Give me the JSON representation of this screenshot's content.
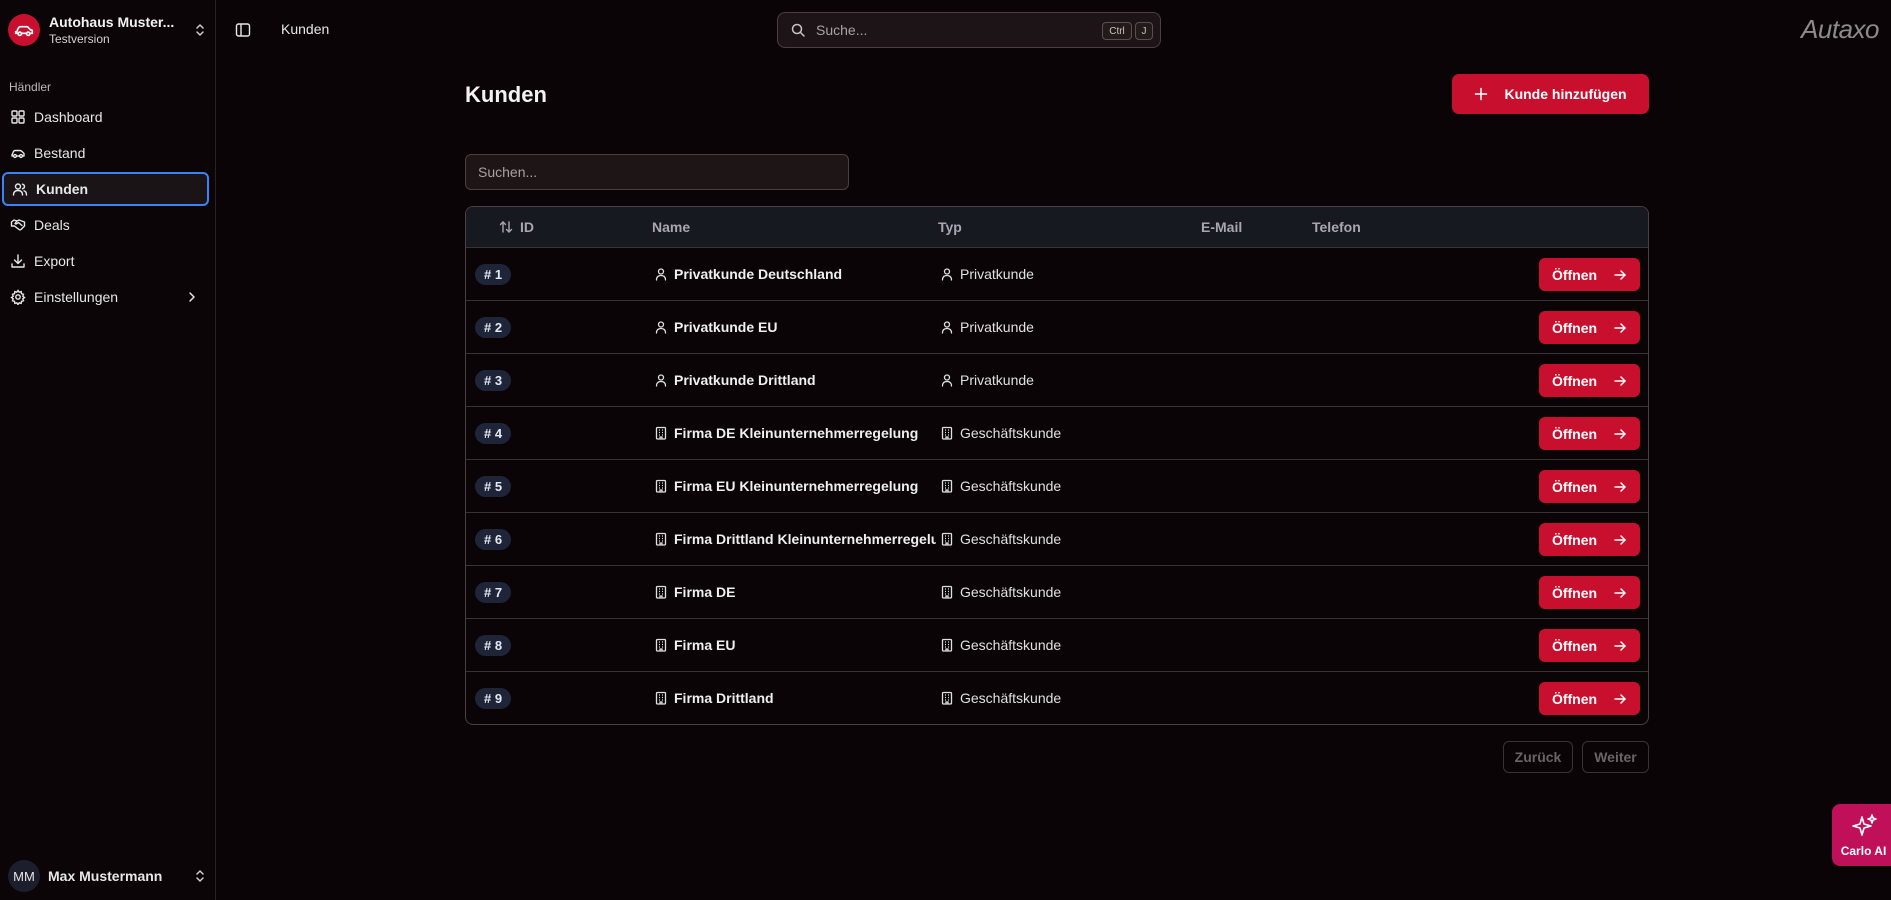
{
  "sidebar": {
    "org_name": "Autohaus Muster...",
    "org_sub": "Testversion",
    "section_label": "Händler",
    "items": [
      {
        "label": "Dashboard",
        "icon": "dashboard-icon"
      },
      {
        "label": "Bestand",
        "icon": "car-icon"
      },
      {
        "label": "Kunden",
        "icon": "users-icon",
        "active": true
      },
      {
        "label": "Deals",
        "icon": "handshake-icon"
      },
      {
        "label": "Export",
        "icon": "download-icon"
      },
      {
        "label": "Einstellungen",
        "icon": "settings-icon",
        "has_submenu": true
      }
    ],
    "user_initials": "MM",
    "user_name": "Max Mustermann"
  },
  "topbar": {
    "breadcrumb": "Kunden",
    "search_placeholder": "Suche...",
    "shortcut_ctrl": "Ctrl",
    "shortcut_key": "J",
    "brand": "Autaxo"
  },
  "main": {
    "title": "Kunden",
    "add_button": "Kunde hinzufügen",
    "search_placeholder": "Suchen...",
    "columns": {
      "id": "ID",
      "name": "Name",
      "typ": "Typ",
      "email": "E-Mail",
      "telefon": "Telefon"
    },
    "open_label": "Öffnen",
    "rows": [
      {
        "id": "# 1",
        "name": "Privatkunde Deutschland",
        "typ": "Privatkunde",
        "kind": "person"
      },
      {
        "id": "# 2",
        "name": "Privatkunde EU",
        "typ": "Privatkunde",
        "kind": "person"
      },
      {
        "id": "# 3",
        "name": "Privatkunde Drittland",
        "typ": "Privatkunde",
        "kind": "person"
      },
      {
        "id": "# 4",
        "name": "Firma DE Kleinunternehmerregelung",
        "typ": "Geschäftskunde",
        "kind": "building"
      },
      {
        "id": "# 5",
        "name": "Firma EU Kleinunternehmerregelung",
        "typ": "Geschäftskunde",
        "kind": "building"
      },
      {
        "id": "# 6",
        "name": "Firma Drittland Kleinunternehmerregelung",
        "typ": "Geschäftskunde",
        "kind": "building"
      },
      {
        "id": "# 7",
        "name": "Firma DE",
        "typ": "Geschäftskunde",
        "kind": "building"
      },
      {
        "id": "# 8",
        "name": "Firma EU",
        "typ": "Geschäftskunde",
        "kind": "building"
      },
      {
        "id": "# 9",
        "name": "Firma Drittland",
        "typ": "Geschäftskunde",
        "kind": "building"
      }
    ],
    "pagination": {
      "back": "Zurück",
      "next": "Weiter"
    }
  },
  "assistant": {
    "label": "Carlo AI"
  },
  "colors": {
    "accent": "#c8102e",
    "assistant": "#c0105a",
    "focus": "#3b82f6"
  }
}
